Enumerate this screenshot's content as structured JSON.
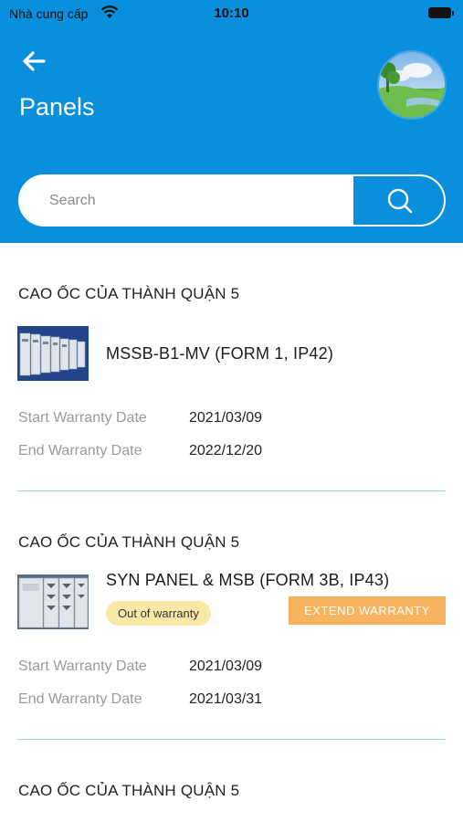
{
  "status_bar": {
    "carrier": "Nhà cung cấp",
    "time": "10:10"
  },
  "header": {
    "title": "Panels"
  },
  "search": {
    "placeholder": "Search"
  },
  "panels": [
    {
      "building": "CAO ỐC CỦA THÀNH QUẬN 5",
      "name": "MSSB-B1-MV (FORM 1, IP42)",
      "start_label": "Start Warranty Date",
      "start_date": "2021/03/09",
      "end_label": "End Warranty Date",
      "end_date": "2022/12/20"
    },
    {
      "building": "CAO ỐC CỦA THÀNH QUẬN 5",
      "name": "SYN PANEL & MSB (FORM 3B, IP43)",
      "status_badge": "Out of warranty",
      "extend_label": "EXTEND WARRANTY",
      "start_label": "Start Warranty Date",
      "start_date": "2021/03/09",
      "end_label": "End Warranty Date",
      "end_date": "2021/03/31"
    },
    {
      "building": "CAO ỐC CỦA THÀNH QUẬN 5"
    }
  ],
  "colors": {
    "primary": "#0a8fdc",
    "badge": "#f9e8a6",
    "extend": "#f7b35e",
    "divider": "#a9d7f1"
  }
}
